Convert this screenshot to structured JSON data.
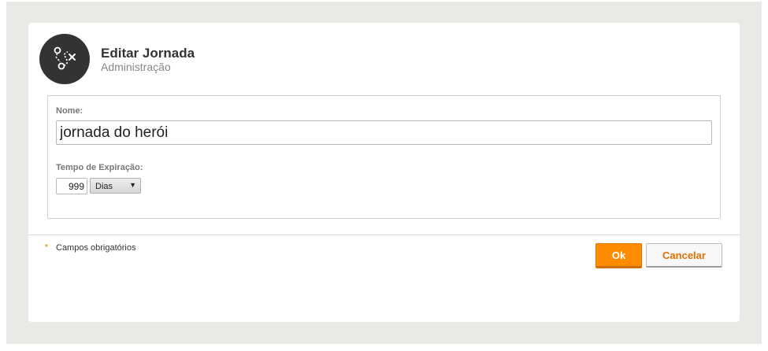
{
  "header": {
    "title": "Editar Jornada",
    "subtitle": "Administração",
    "icon": "journey-path-icon"
  },
  "form": {
    "name_label": "Nome:",
    "name_value": "jornada do herói",
    "expiration_label": "Tempo de Expiração:",
    "expiration_value": "999",
    "expiration_unit": "Dias"
  },
  "footer": {
    "required_mark": "*",
    "required_text": "Campos obrigatórios",
    "ok_label": "Ok",
    "cancel_label": "Cancelar"
  },
  "colors": {
    "accent": "#ff8c00",
    "avatar_bg": "#333333",
    "backdrop": "#ebe9e5"
  }
}
